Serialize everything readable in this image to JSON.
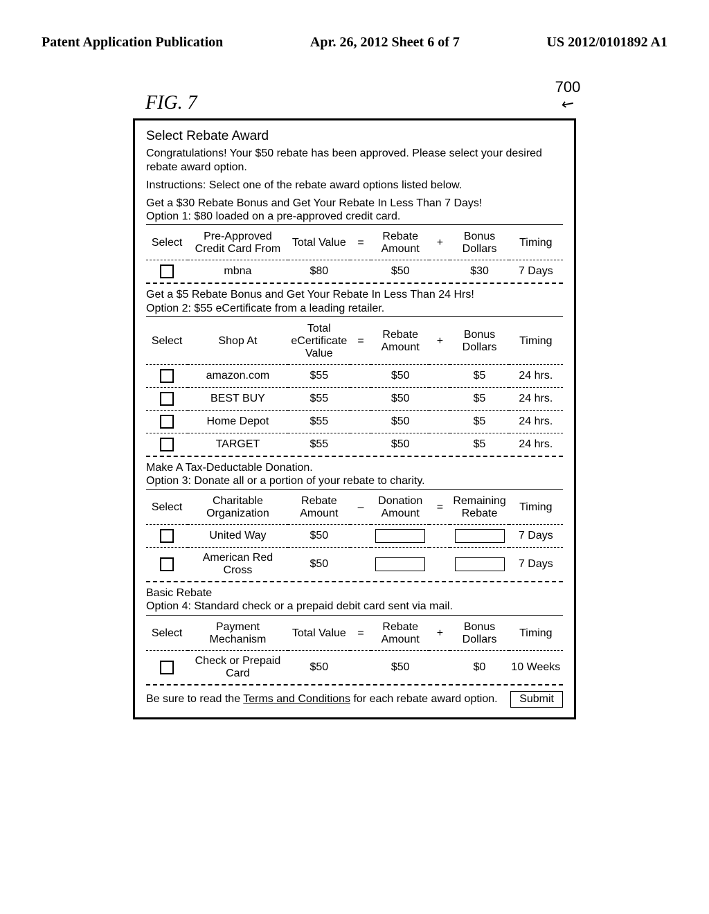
{
  "pub_header": {
    "left": "Patent Application Publication",
    "center": "Apr. 26, 2012  Sheet 6 of 7",
    "right": "US 2012/0101892 A1"
  },
  "figure_label": "FIG. 7",
  "reference_number": "700",
  "panel": {
    "title": "Select Rebate Award",
    "congrats": "Congratulations! Your $50 rebate has been approved. Please select your desired rebate award option.",
    "instructions": "Instructions: Select one of the rebate award options listed below.",
    "option1": {
      "intro_l1": "Get a $30 Rebate Bonus and Get Your Rebate In Less Than 7 Days!",
      "intro_l2": "Option 1: $80 loaded on a pre-approved credit card.",
      "head": {
        "select": "Select",
        "name": "Pre-Approved Credit Card From",
        "value": "Total Value",
        "op1": "=",
        "rebate": "Rebate Amount",
        "op2": "+",
        "bonus": "Bonus Dollars",
        "timing": "Timing"
      },
      "rows": [
        {
          "name": "mbna",
          "value": "$80",
          "rebate": "$50",
          "bonus": "$30",
          "timing": "7 Days"
        }
      ]
    },
    "option2": {
      "intro_l1": "Get a $5 Rebate Bonus and Get Your Rebate In Less Than 24 Hrs!",
      "intro_l2": "Option 2: $55 eCertificate from a leading retailer.",
      "head": {
        "select": "Select",
        "name": "Shop At",
        "value": "Total eCertificate Value",
        "op1": "=",
        "rebate": "Rebate Amount",
        "op2": "+",
        "bonus": "Bonus Dollars",
        "timing": "Timing"
      },
      "rows": [
        {
          "name": "amazon.com",
          "value": "$55",
          "rebate": "$50",
          "bonus": "$5",
          "timing": "24 hrs."
        },
        {
          "name": "BEST BUY",
          "value": "$55",
          "rebate": "$50",
          "bonus": "$5",
          "timing": "24 hrs."
        },
        {
          "name": "Home Depot",
          "value": "$55",
          "rebate": "$50",
          "bonus": "$5",
          "timing": "24 hrs."
        },
        {
          "name": "TARGET",
          "value": "$55",
          "rebate": "$50",
          "bonus": "$5",
          "timing": "24 hrs."
        }
      ]
    },
    "option3": {
      "intro_l1": "Make A Tax-Deductable Donation.",
      "intro_l2": "Option 3: Donate all or a portion of your rebate to charity.",
      "head": {
        "select": "Select",
        "name": "Charitable Organization",
        "value": "Rebate Amount",
        "op1": "–",
        "rebate": "Donation Amount",
        "op2": "=",
        "bonus": "Remaining Rebate",
        "timing": "Timing"
      },
      "rows": [
        {
          "name": "United Way",
          "value": "$50",
          "timing": "7 Days"
        },
        {
          "name": "American Red Cross",
          "value": "$50",
          "timing": "7 Days"
        }
      ]
    },
    "option4": {
      "intro_l1": "Basic Rebate",
      "intro_l2": "Option 4: Standard check or a prepaid debit card sent via mail.",
      "head": {
        "select": "Select",
        "name": "Payment Mechanism",
        "value": "Total Value",
        "op1": "=",
        "rebate": "Rebate Amount",
        "op2": "+",
        "bonus": "Bonus Dollars",
        "timing": "Timing"
      },
      "rows": [
        {
          "name": "Check or Prepaid Card",
          "value": "$50",
          "rebate": "$50",
          "bonus": "$0",
          "timing": "10 Weeks"
        }
      ]
    },
    "footer_pre": "Be sure to read the ",
    "footer_link": "Terms and Conditions",
    "footer_post": " for each rebate award option.",
    "submit": "Submit"
  }
}
